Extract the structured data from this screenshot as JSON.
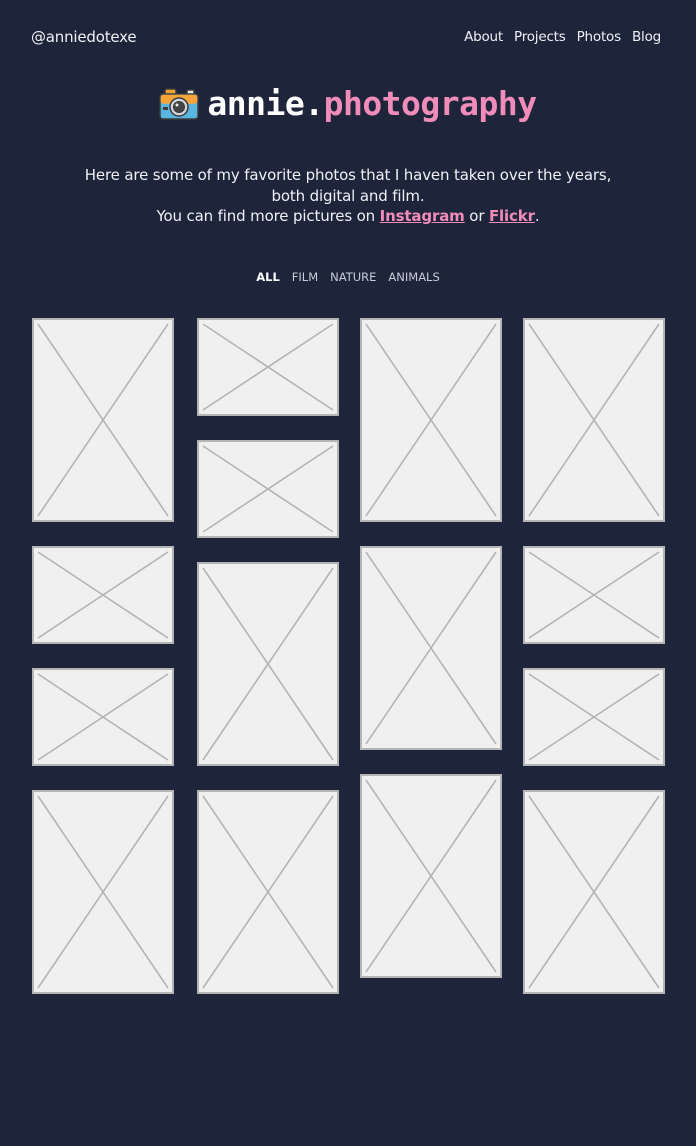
{
  "header": {
    "handle": "@anniedotexe",
    "nav": [
      "About",
      "Projects",
      "Photos",
      "Blog"
    ]
  },
  "logo": {
    "icon": "camera-icon",
    "name_first": "annie.",
    "name_second": "photography"
  },
  "intro": {
    "line1": "Here are some of my favorite photos that I haven taken over the years,",
    "line2": "both digital and film.",
    "line3_prefix": "You can find more pictures on ",
    "instagram": "Instagram",
    "joiner": " or ",
    "flickr": "Flickr",
    "suffix": "."
  },
  "filters": {
    "items": [
      "ALL",
      "FILM",
      "NATURE",
      "ANIMALS"
    ],
    "active": "ALL"
  },
  "gallery": {
    "placeholder_icon": "image-placeholder",
    "columns": [
      [
        "portrait",
        "landscape",
        "landscape",
        "portrait"
      ],
      [
        "landscape",
        "landscape",
        "portrait",
        "portrait"
      ],
      [
        "portrait",
        "portrait",
        "portrait"
      ],
      [
        "portrait",
        "landscape",
        "landscape",
        "portrait"
      ]
    ]
  },
  "colors": {
    "background": "#1e253a",
    "accent": "#f08cb9",
    "text": "#eef0f5",
    "placeholder_fill": "#f0f0f0",
    "placeholder_stroke": "#b4b4b4"
  }
}
